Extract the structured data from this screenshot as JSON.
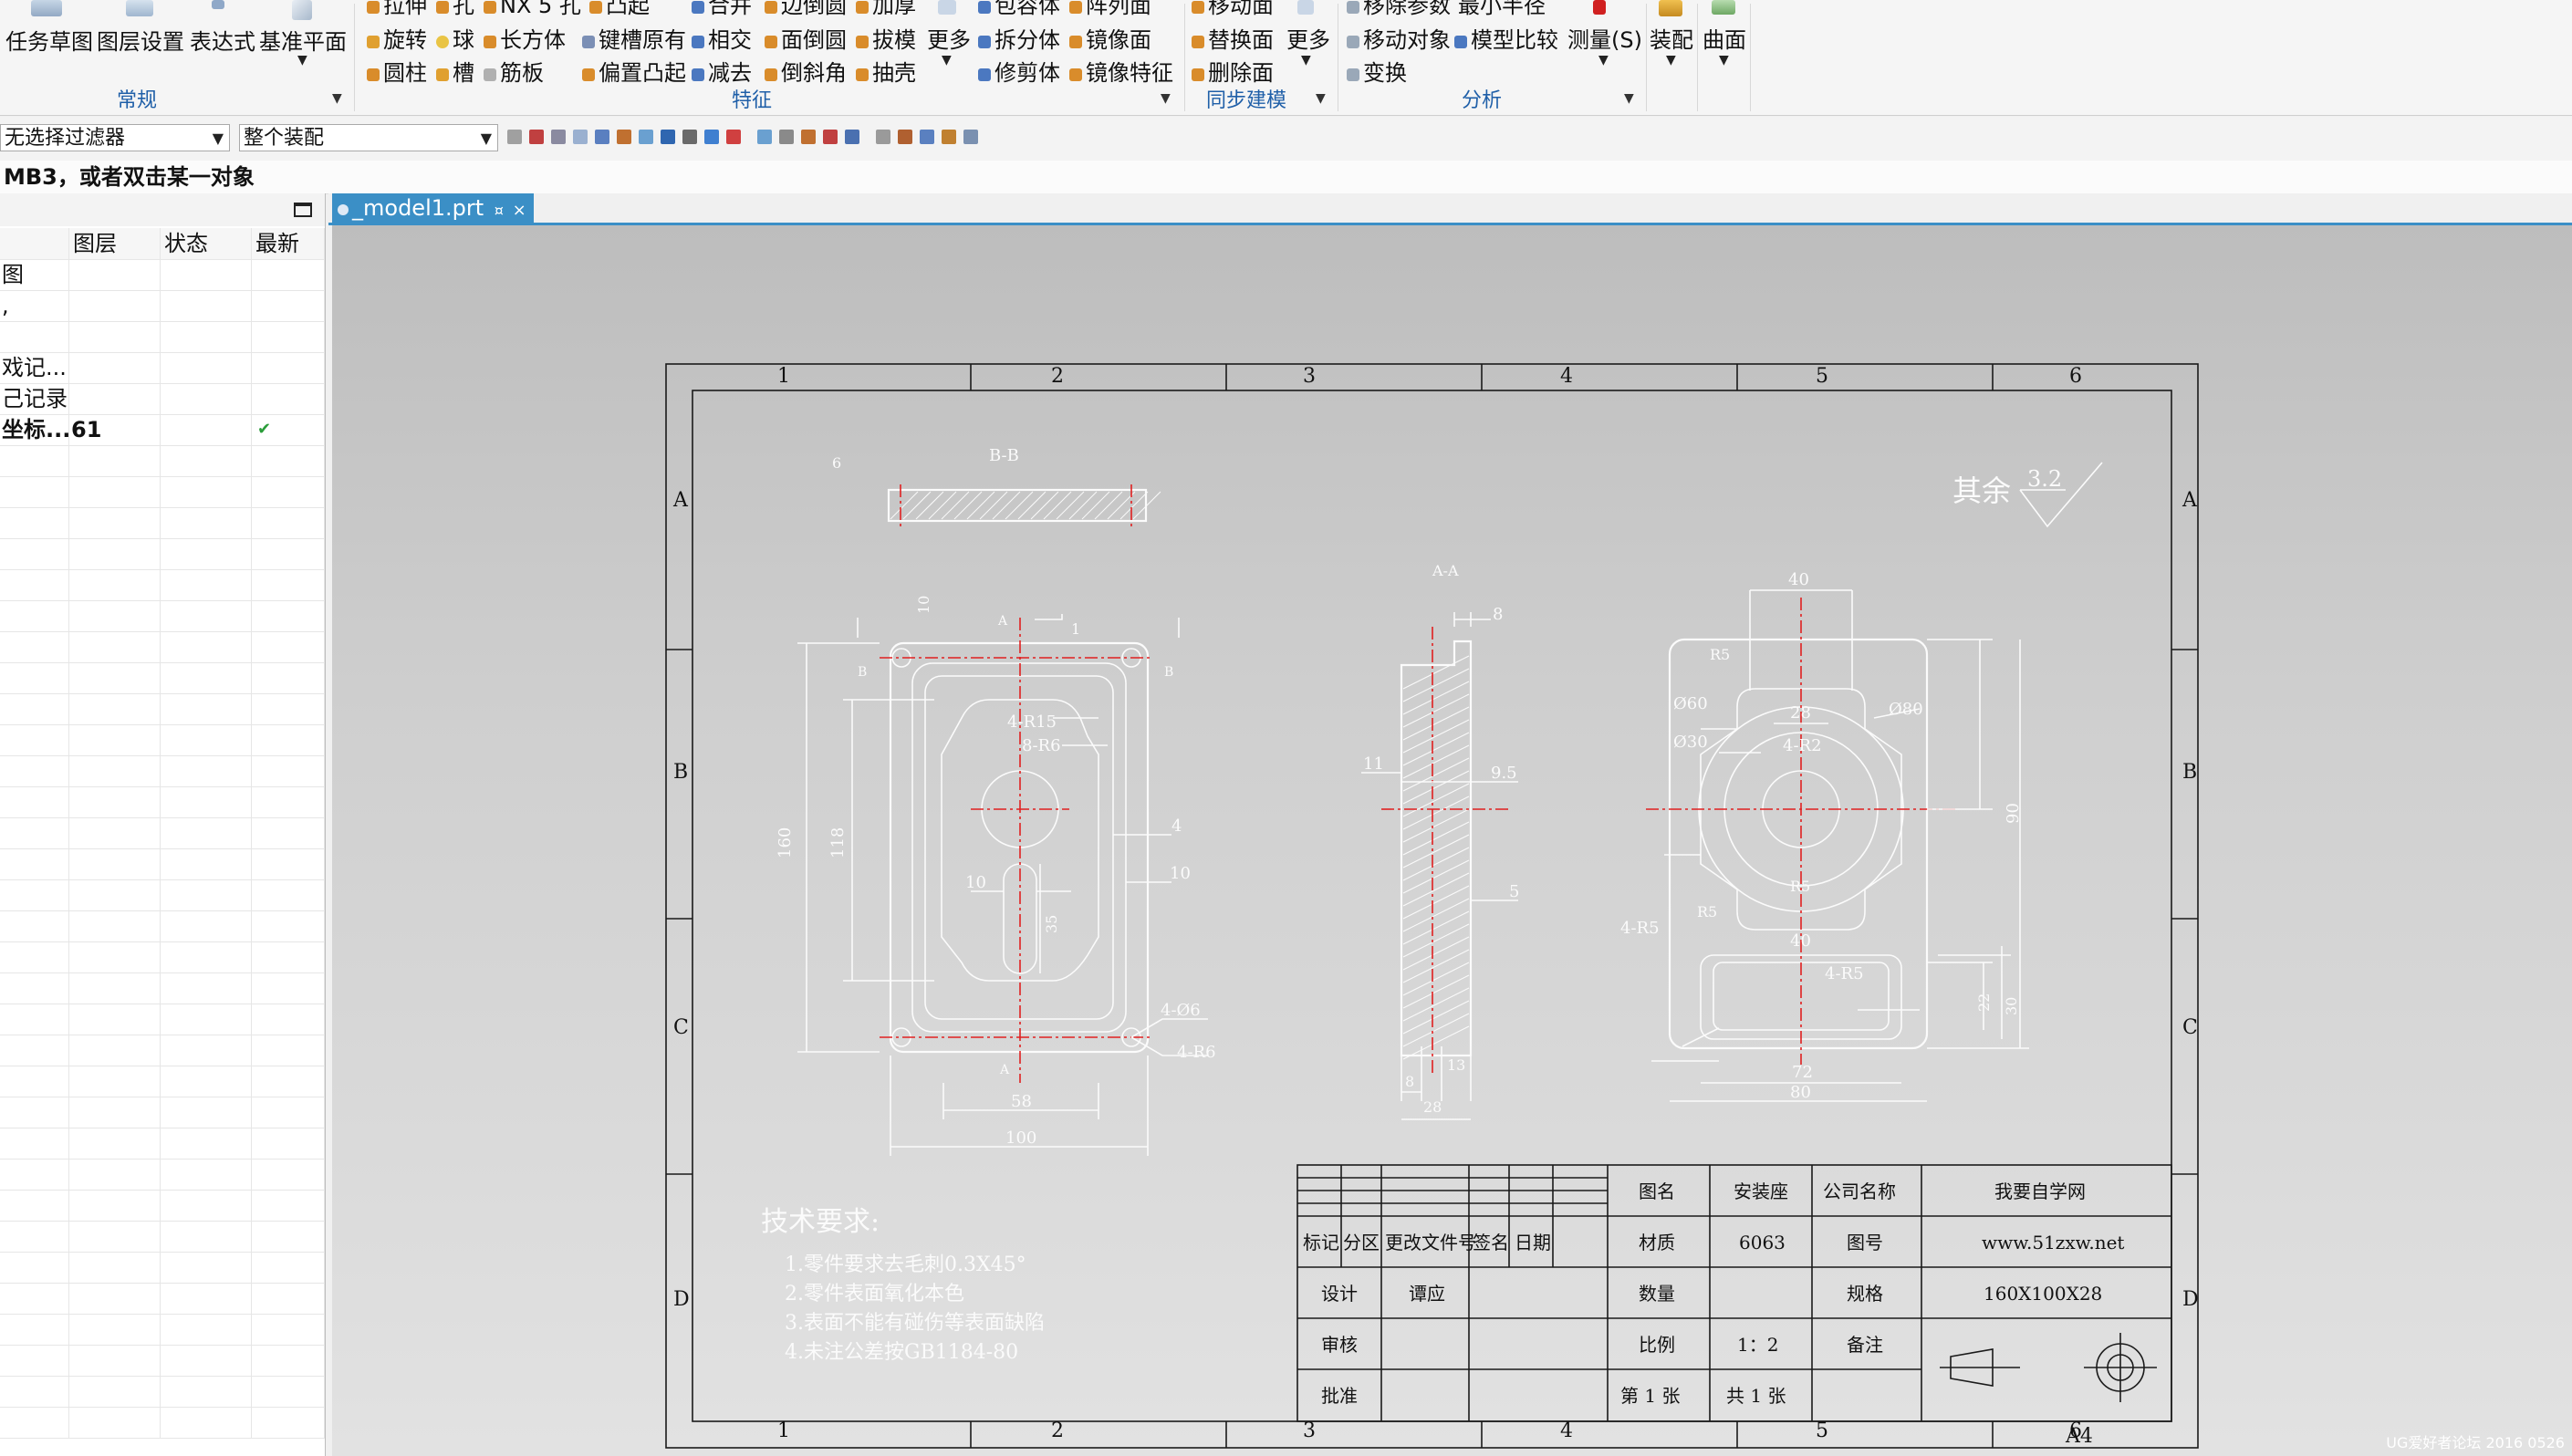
{
  "ribbon": {
    "groups": [
      {
        "name": "常规"
      },
      {
        "name": "特征"
      },
      {
        "name": "同步建模"
      },
      {
        "name": "分析"
      }
    ],
    "big_buttons": {
      "task_sketch": "任务草图",
      "layer_settings": "图层设置",
      "expression": "表达式",
      "datum_plane": "基准平面",
      "measure": "测量(S)",
      "assembly": "装配",
      "surface": "曲面"
    },
    "feature_items": {
      "extrude": "拉伸",
      "hole": "孔",
      "nx5_hole": "NX 5 孔",
      "boss": "凸起",
      "revolve": "旋转",
      "sphere": "球",
      "block": "长方体",
      "slot_keyed": "键槽原有",
      "cylinder": "圆柱",
      "slot": "槽",
      "rib": "筋板",
      "offset_boss": "偏置凸起",
      "unite": "合并",
      "edge_blend": "边倒圆",
      "thicken": "加厚",
      "intersect": "相交",
      "face_blend": "面倒圆",
      "draft": "拔模",
      "subtract": "减去",
      "chamfer": "倒斜角",
      "shell": "抽壳",
      "more": "更多",
      "wrap_geometry": "包容体",
      "pattern_face": "阵列面",
      "split_body": "拆分体",
      "mirror_face": "镜像面",
      "trim_body": "修剪体",
      "mirror_feature": "镜像特征"
    },
    "sync_items": {
      "move_face": "移动面",
      "replace_face": "替换面",
      "delete_face": "删除面",
      "more": "更多"
    },
    "analysis_items": {
      "remove_params": "移除参数",
      "min_radius": "最小半径",
      "move_object": "移动对象",
      "model_compare": "模型比较",
      "transform": "变换"
    }
  },
  "toolbar2": {
    "selection_filter": "无选择过滤器",
    "assembly_scope": "整个装配"
  },
  "cue_line": "MB3，或者双击某一对象",
  "navigator": {
    "columns": [
      "图层",
      "状态",
      "最新"
    ],
    "rows": [
      {
        "name": "图",
        "layer": "",
        "status": "",
        "latest": ""
      },
      {
        "name": ",",
        "layer": "",
        "status": "",
        "latest": ""
      },
      {
        "name": "",
        "layer": "",
        "status": "",
        "latest": ""
      },
      {
        "name": "戏记...",
        "layer": "",
        "status": "",
        "latest": ""
      },
      {
        "name": "己记录",
        "layer": "",
        "status": "",
        "latest": ""
      },
      {
        "name": "坐标...",
        "layer": "61",
        "status": "",
        "latest": "✔"
      }
    ]
  },
  "document_tab": {
    "label": "_model1.prt",
    "modified_mark": "¤",
    "close": "×"
  },
  "drawing": {
    "zone_columns": [
      "1",
      "2",
      "3",
      "4",
      "5",
      "6"
    ],
    "zone_rows": [
      "A",
      "B",
      "C",
      "D"
    ],
    "roughness_note": "其余",
    "roughness_value": "3.2",
    "section_bb": "B-B",
    "section_aa": "A-A",
    "dims_front": {
      "d100": "100",
      "d58": "58",
      "d160": "160",
      "d118": "118",
      "d10a": "10",
      "d10b": "10",
      "d10c": "10",
      "d35": "35",
      "d4": "4",
      "d4r15": "4-R15",
      "d8r6": "8-R6",
      "d4phi6": "4-Ø6",
      "d4r6": "4-R6",
      "d6": "6",
      "d1": "1",
      "lbl_a": "A",
      "lbl_b": "B"
    },
    "dims_side": {
      "d8a": "8",
      "d11": "11",
      "d9_5": "9.5",
      "d5": "5",
      "d8b": "8",
      "d13": "13",
      "d28": "28"
    },
    "dims_top": {
      "d40": "40",
      "d28": "28",
      "d4r2": "4-R2",
      "r5a": "R5",
      "phi60": "Ø60",
      "phi30": "Ø30",
      "phi80": "Ø80",
      "d55": "55",
      "d90": "90",
      "r5b": "R5",
      "r5c": "R5",
      "d4r5a": "4-R5",
      "d40b": "40",
      "d4r5b": "4-R5",
      "d22": "22",
      "d30": "30",
      "d72": "72",
      "d80": "80"
    },
    "tech_req_title": "技术要求:",
    "tech_req_items": [
      "1.零件要求去毛刺0.3X45°",
      "2.零件表面氧化本色",
      "3.表面不能有碰伤等表面缺陷",
      "4.未注公差按GB1184-80"
    ],
    "title_block": {
      "biaoji": "标记",
      "fenqu": "分区",
      "gaiwenjian": "更改文件号",
      "qianming": "签名",
      "riqi": "日期",
      "sheji": "设计",
      "designer": "谭应",
      "shenhe": "审核",
      "pizhun": "批准",
      "tuming": "图名",
      "tuming_val": "安装座",
      "gongsi": "公司名称",
      "gongsi_val": "我要自学网",
      "caizhi": "材质",
      "caizhi_val": "6063",
      "tuhao": "图号",
      "tuhao_val": "www.51zxw.net",
      "shuliang": "数量",
      "guige": "规格",
      "guige_val": "160X100X28",
      "bili": "比例",
      "bili_val": "1：2",
      "beizhu": "备注",
      "di": "第 1 张",
      "gong": "共 1 张"
    },
    "sheet_size": "A4"
  },
  "watermark": "UG爱好者论坛 2016 0526"
}
